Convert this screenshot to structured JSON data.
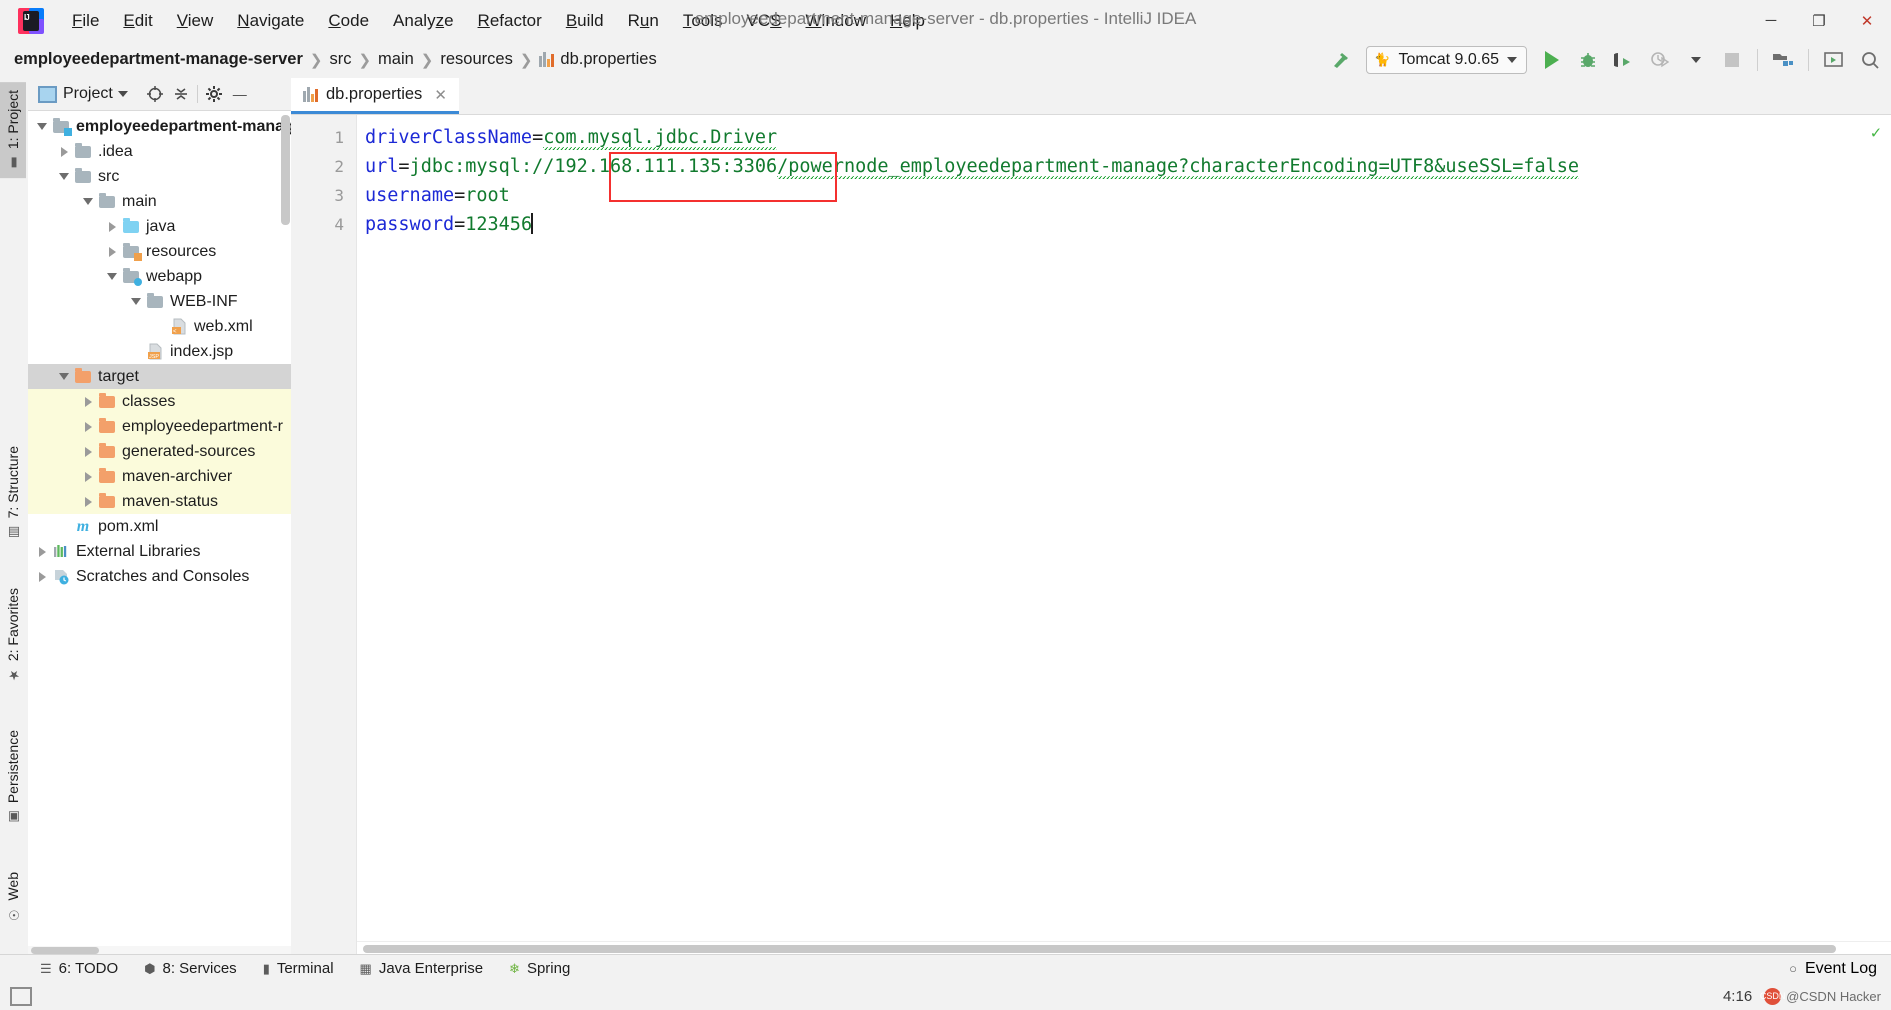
{
  "window": {
    "title": "employeedepartment-manage-server - db.properties - IntelliJ IDEA",
    "logo_alt": "intellij-idea-logo",
    "minimize": "─",
    "maximize": "❐",
    "close": "✕"
  },
  "menu": [
    {
      "label": "File",
      "mnemonic": "F"
    },
    {
      "label": "Edit",
      "mnemonic": "E"
    },
    {
      "label": "View",
      "mnemonic": "V"
    },
    {
      "label": "Navigate",
      "mnemonic": "N"
    },
    {
      "label": "Code",
      "mnemonic": "C"
    },
    {
      "label": "Analyze",
      "mnemonic": "z"
    },
    {
      "label": "Refactor",
      "mnemonic": "R"
    },
    {
      "label": "Build",
      "mnemonic": "B"
    },
    {
      "label": "Run",
      "mnemonic": "u"
    },
    {
      "label": "Tools",
      "mnemonic": "T"
    },
    {
      "label": "VCS",
      "mnemonic": "S"
    },
    {
      "label": "Window",
      "mnemonic": "W"
    },
    {
      "label": "Help",
      "mnemonic": "H"
    }
  ],
  "breadcrumbs": [
    {
      "label": "employeedepartment-manage-server",
      "icon": "none",
      "bold": true
    },
    {
      "label": "src",
      "icon": "none",
      "bold": false
    },
    {
      "label": "main",
      "icon": "none",
      "bold": false
    },
    {
      "label": "resources",
      "icon": "none",
      "bold": false
    },
    {
      "label": "db.properties",
      "icon": "properties-file-icon",
      "bold": false
    }
  ],
  "breadcrumb_separator": "❯",
  "toolbar": {
    "build_hammer_icon": "build-hammer-icon",
    "run_config": {
      "label": "Tomcat 9.0.65",
      "icon": "tomcat-cat-icon",
      "dropdown": "▼"
    },
    "run_icon": "run-play-icon",
    "debug_icon": "debug-bug-icon",
    "run_coverage_icon": "run-with-coverage-icon",
    "profiler_icon": "profiler-clock-icon",
    "profiler_dropdown": "▼",
    "stop_icon": "stop-square-icon",
    "project_structure_icon": "project-structure-icon",
    "updates_icon": "present-window-icon",
    "search_icon": "search-everywhere-icon"
  },
  "left_stripe": [
    {
      "label": "1: Project",
      "mnemonic": "1",
      "icon": "project-folder-icon",
      "active": true
    },
    {
      "label": "7: Structure",
      "mnemonic": "7",
      "icon": "structure-icon",
      "active": false
    },
    {
      "label": "2: Favorites",
      "mnemonic": "2",
      "icon": "favorites-star-icon",
      "active": false
    },
    {
      "label": "Persistence",
      "mnemonic": "",
      "icon": "persistence-icon",
      "active": false
    },
    {
      "label": "Web",
      "mnemonic": "",
      "icon": "web-globe-icon",
      "active": false
    }
  ],
  "project_panel": {
    "title": "Project",
    "title_dropdown": "▼",
    "locate_icon": "locate-target-icon",
    "collapse_icon": "collapse-all-icon",
    "settings_icon": "gear-icon",
    "hide_icon": "hide-minimize-icon",
    "tree": [
      {
        "label": "employeedepartment-manag",
        "depth": 0,
        "state": "expanded",
        "icon": "module-folder-icon",
        "bold": true,
        "highlight": "none"
      },
      {
        "label": ".idea",
        "depth": 1,
        "state": "collapsed",
        "icon": "folder-icon",
        "bold": false,
        "highlight": "none"
      },
      {
        "label": "src",
        "depth": 1,
        "state": "expanded",
        "icon": "folder-icon",
        "bold": false,
        "highlight": "none"
      },
      {
        "label": "main",
        "depth": 2,
        "state": "expanded",
        "icon": "folder-icon",
        "bold": false,
        "highlight": "none"
      },
      {
        "label": "java",
        "depth": 3,
        "state": "collapsed",
        "icon": "source-folder-icon",
        "bold": false,
        "highlight": "none"
      },
      {
        "label": "resources",
        "depth": 3,
        "state": "collapsed",
        "icon": "resources-folder-icon",
        "bold": false,
        "highlight": "none"
      },
      {
        "label": "webapp",
        "depth": 3,
        "state": "expanded",
        "icon": "webapp-folder-icon",
        "bold": false,
        "highlight": "none"
      },
      {
        "label": "WEB-INF",
        "depth": 4,
        "state": "expanded",
        "icon": "folder-icon",
        "bold": false,
        "highlight": "none"
      },
      {
        "label": "web.xml",
        "depth": 5,
        "state": "leaf",
        "icon": "xml-file-icon",
        "bold": false,
        "highlight": "none"
      },
      {
        "label": "index.jsp",
        "depth": 4,
        "state": "leaf",
        "icon": "jsp-file-icon",
        "bold": false,
        "highlight": "none"
      },
      {
        "label": "target",
        "depth": 1,
        "state": "expanded",
        "icon": "excluded-folder-icon",
        "bold": false,
        "highlight": "selected"
      },
      {
        "label": "classes",
        "depth": 2,
        "state": "collapsed",
        "icon": "excluded-folder-icon",
        "bold": false,
        "highlight": "yellow"
      },
      {
        "label": "employeedepartment-r",
        "depth": 2,
        "state": "collapsed",
        "icon": "excluded-folder-icon",
        "bold": false,
        "highlight": "yellow"
      },
      {
        "label": "generated-sources",
        "depth": 2,
        "state": "collapsed",
        "icon": "excluded-folder-icon",
        "bold": false,
        "highlight": "yellow"
      },
      {
        "label": "maven-archiver",
        "depth": 2,
        "state": "collapsed",
        "icon": "excluded-folder-icon",
        "bold": false,
        "highlight": "yellow"
      },
      {
        "label": "maven-status",
        "depth": 2,
        "state": "collapsed",
        "icon": "excluded-folder-icon",
        "bold": false,
        "highlight": "yellow"
      },
      {
        "label": "pom.xml",
        "depth": 1,
        "state": "leaf",
        "icon": "maven-pom-icon",
        "bold": false,
        "highlight": "none"
      },
      {
        "label": "External Libraries",
        "depth": 0,
        "state": "collapsed",
        "icon": "external-libraries-icon",
        "bold": false,
        "highlight": "none"
      },
      {
        "label": "Scratches and Consoles",
        "depth": 0,
        "state": "collapsed",
        "icon": "scratches-icon",
        "bold": false,
        "highlight": "none"
      }
    ]
  },
  "editor": {
    "tab": {
      "label": "db.properties",
      "icon": "properties-file-icon",
      "close": "✕"
    },
    "line_numbers": [
      "1",
      "2",
      "3",
      "4"
    ],
    "inspection_ok_icon": "✓",
    "lines": [
      {
        "key": "driverClassName",
        "eq": "=",
        "value": "com.mysql.jdbc.Driver"
      },
      {
        "key": "url",
        "eq": "=",
        "value_prefix": "jdbc:mysql://",
        "value_host": "192.168.111.135:3306",
        "value_suffix": "/powernode_employeedepartment-manage?characterEncoding=UTF8&useSSL=false"
      },
      {
        "key": "username",
        "eq": "=",
        "value": "root"
      },
      {
        "key": "password",
        "eq": "=",
        "value": "123456"
      }
    ],
    "highlight_box": {
      "label": "red-annotation-box",
      "color": "#f4302f"
    }
  },
  "bottom_bar": [
    {
      "label": "6: TODO",
      "mnemonic": "6",
      "icon": "todo-list-icon"
    },
    {
      "label": "8: Services",
      "mnemonic": "8",
      "icon": "services-icon"
    },
    {
      "label": "Terminal",
      "mnemonic": "",
      "icon": "terminal-icon"
    },
    {
      "label": "Java Enterprise",
      "mnemonic": "",
      "icon": "java-enterprise-icon"
    },
    {
      "label": "Spring",
      "mnemonic": "",
      "icon": "spring-leaf-icon"
    }
  ],
  "status": {
    "event_log": "Event Log",
    "event_log_icon": "event-log-icon",
    "time": "4:16",
    "watermark_text": "@CSDN Hacker",
    "watermark_badge": "CSDN"
  },
  "colors": {
    "accent_blue": "#3c8ad6",
    "key_blue": "#1c29d6",
    "value_green": "#117a2e",
    "highlight_red": "#f4302f",
    "selection_gray": "#d4d4d4",
    "excluded_yellow": "#fbfbdb",
    "excluded_orange": "#f3a06a"
  }
}
